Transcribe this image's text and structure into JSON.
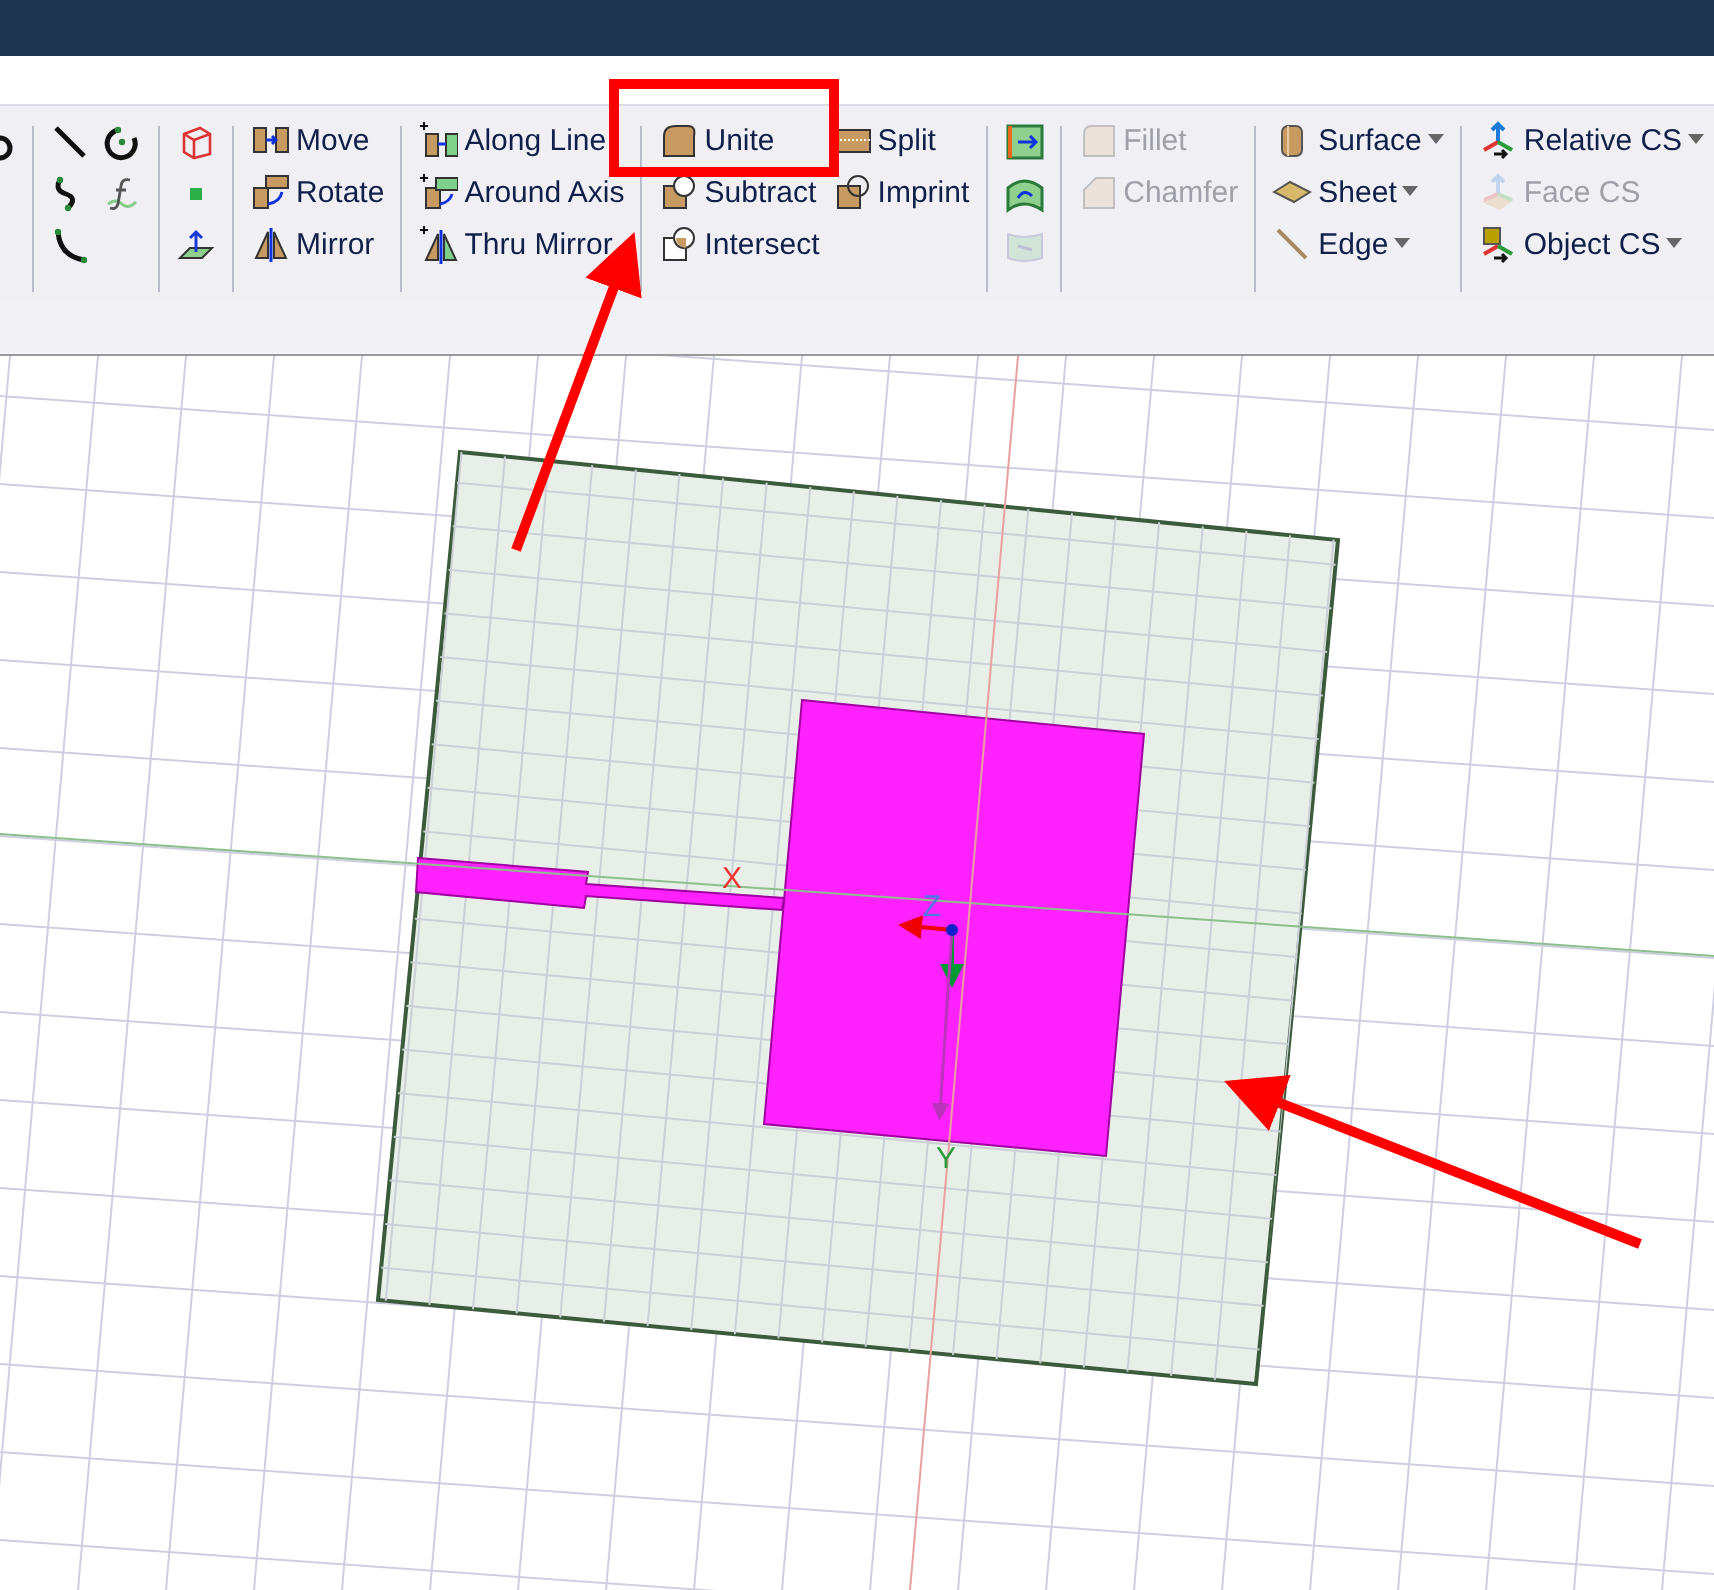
{
  "toolbar": {
    "groups": [
      {
        "kind": "icons",
        "columns": [
          [
            {
              "disabled": false
            },
            {
              "disabled": false
            },
            {
              "disabled": false
            }
          ],
          [
            {
              "disabled": false
            },
            {
              "disabled": false
            }
          ]
        ]
      },
      {
        "kind": "icons",
        "columns": [
          [
            {
              "disabled": false
            },
            {
              "disabled": false
            },
            {
              "disabled": false
            }
          ]
        ]
      },
      {
        "kind": "commands",
        "columns": [
          [
            {
              "label": "Move",
              "disabled": false,
              "dropdown": false
            },
            {
              "label": "Rotate",
              "disabled": false,
              "dropdown": false
            },
            {
              "label": "Mirror",
              "disabled": false,
              "dropdown": false
            }
          ]
        ]
      },
      {
        "kind": "commands",
        "columns": [
          [
            {
              "label": "Along Line",
              "disabled": false,
              "dropdown": false
            },
            {
              "label": "Around Axis",
              "disabled": false,
              "dropdown": false
            },
            {
              "label": "Thru Mirror",
              "disabled": false,
              "dropdown": false
            }
          ]
        ]
      },
      {
        "kind": "commands",
        "columns": [
          [
            {
              "label": "Unite",
              "disabled": false,
              "dropdown": false
            },
            {
              "label": "Subtract",
              "disabled": false,
              "dropdown": false
            },
            {
              "label": "Intersect",
              "disabled": false,
              "dropdown": false
            }
          ],
          [
            {
              "label": "Split",
              "disabled": false,
              "dropdown": false
            },
            {
              "label": "Imprint",
              "disabled": false,
              "dropdown": false
            }
          ]
        ]
      },
      {
        "kind": "icons",
        "columns": [
          [
            {
              "disabled": false
            },
            {
              "disabled": false
            },
            {
              "disabled": true
            }
          ]
        ]
      },
      {
        "kind": "commands",
        "columns": [
          [
            {
              "label": "Fillet",
              "disabled": true,
              "dropdown": false
            },
            {
              "label": "Chamfer",
              "disabled": true,
              "dropdown": false
            }
          ]
        ]
      },
      {
        "kind": "commands",
        "columns": [
          [
            {
              "label": "Surface",
              "disabled": false,
              "dropdown": true
            },
            {
              "label": "Sheet",
              "disabled": false,
              "dropdown": true
            },
            {
              "label": "Edge",
              "disabled": false,
              "dropdown": true
            }
          ]
        ]
      },
      {
        "kind": "commands",
        "columns": [
          [
            {
              "label": "Relative CS",
              "disabled": false,
              "dropdown": true
            },
            {
              "label": "Face CS",
              "disabled": true,
              "dropdown": false
            },
            {
              "label": "Object CS",
              "disabled": false,
              "dropdown": true
            }
          ]
        ]
      }
    ]
  },
  "viewport": {
    "axis_labels": [
      {
        "kind": "x",
        "text": "X"
      },
      {
        "kind": "z",
        "text": "Z"
      },
      {
        "kind": "y",
        "text": "Y"
      }
    ]
  }
}
